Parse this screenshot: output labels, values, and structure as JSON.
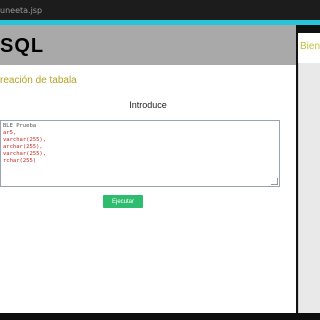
{
  "browser": {
    "url": "uneeta.jsp"
  },
  "header": {
    "logo": "SQL",
    "welcome": "Bienve"
  },
  "main": {
    "subtitle": "reación de tabala",
    "label": "Introduce",
    "editor_lines": [
      "BLE Prueba",
      "",
      "ar5,",
      "varchar(255),",
      "archar(255),",
      "varchar(255),",
      "rchar(255)",
      "",
      "",
      "",
      ""
    ],
    "button": "Ejecutar"
  },
  "colors": {
    "accent": "#26c6da",
    "header_bg": "#a9a9a9",
    "subtitle": "#b4a224",
    "button": "#2ebd6f"
  }
}
